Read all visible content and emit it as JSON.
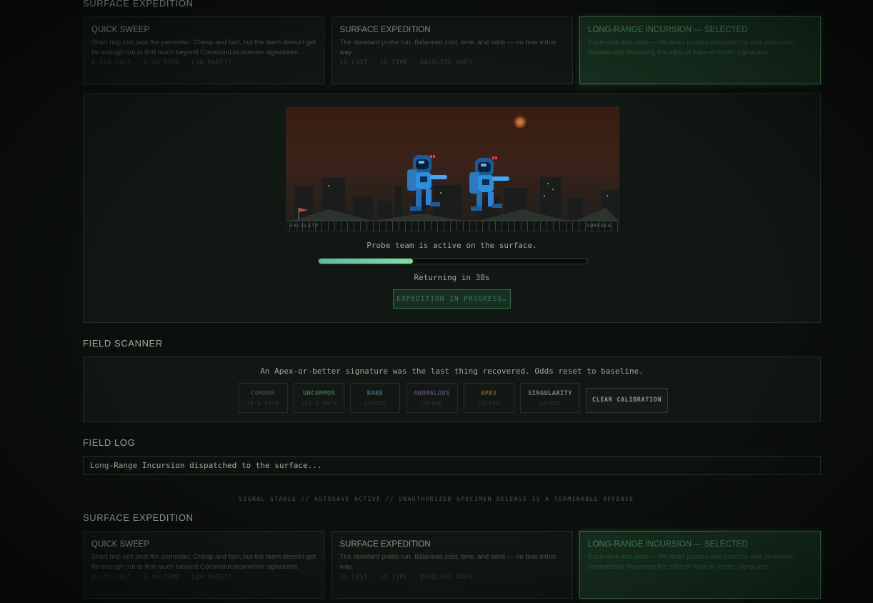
{
  "expedition": {
    "title": "SURFACE EXPEDITION",
    "cards": [
      {
        "title": "QUICK SWEEP",
        "desc": "Short hop just past the perimeter. Cheap and fast, but the team doesn't get far enough out to find much beyond Common/Uncommon signatures.",
        "meta": "0.45X COST · 0.4X TIME · LOW RARITY",
        "selected": false
      },
      {
        "title": "SURFACE EXPEDITION",
        "desc": "The standard probe run. Balanced cost, time, and odds — no bias either way.",
        "meta": "1X COST · 1X TIME · BASELINE ODDS",
        "selected": false
      },
      {
        "title": "LONG-RANGE INCURSION — SELECTED",
        "desc": "Expensive and slow — the team pushes well past the safe perimeter, dramatically improving the odds of Rare-or-better signatures.",
        "meta": "",
        "selected": true
      }
    ],
    "scene": {
      "label_left": "FACILITY",
      "label_right": "SURFACE"
    },
    "status": "Probe team is active on the surface.",
    "progress": 0.35,
    "returning": "Returning in 38s",
    "button": "EXPEDITION IN PROGRESS…"
  },
  "scanner": {
    "title": "FIELD SCANNER",
    "message": "An Apex-or-better signature was the last thing recovered. Odds reset to baseline.",
    "chips": [
      {
        "name": "COMMON",
        "value": "40.0 DATA",
        "color": "#3d4a41"
      },
      {
        "name": "UNCOMMON",
        "value": "120.0 DATA",
        "color": "#3f6e4c"
      },
      {
        "name": "RARE",
        "value": "LOCKED",
        "color": "#3c6573"
      },
      {
        "name": "ANOMALOUS",
        "value": "LOCKED",
        "color": "#5d4a72"
      },
      {
        "name": "APEX",
        "value": "LOCKED",
        "color": "#7a5a2c"
      },
      {
        "name": "SINGULARITY",
        "value": "LOCKED",
        "color": "#7c8580"
      }
    ],
    "clear_label": "CLEAR CALIBRATION"
  },
  "log": {
    "title": "FIELD LOG",
    "entry": "Long-Range Incursion dispatched to the surface..."
  },
  "footer": "SIGNAL STABLE // AUTOSAVE ACTIVE // UNAUTHORIZED SPECIMEN RELEASE IS A TERMINABLE OFFENSE"
}
